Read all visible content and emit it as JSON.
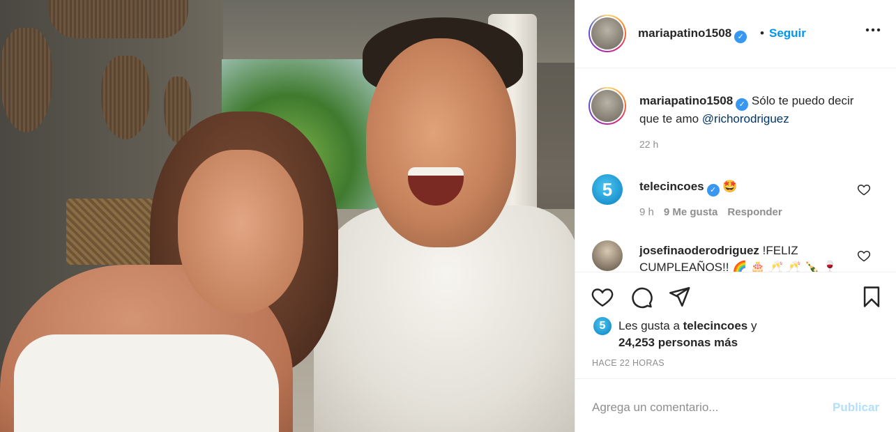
{
  "post": {
    "username": "mariapatino1508",
    "follow_label": "Seguir",
    "separator": "•",
    "more_icon": "more-horizontal-icon",
    "caption": {
      "username": "mariapatino1508",
      "text": "Sólo te puedo decir que te amo ",
      "mention": "@richorodriguez",
      "time": "22 h"
    },
    "comments": [
      {
        "username": "telecincoes",
        "avatar_text": "5",
        "text": "🤩",
        "time": "9 h",
        "likes": "9 Me gusta",
        "reply_label": "Responder"
      },
      {
        "username": "josefinaoderodriguez",
        "text": "!FELIZ CUMPLEAÑOS!! 🌈 🎂 🥂 🥂 🍾 🍷"
      }
    ],
    "likes": {
      "prefix": "Les gusta a ",
      "user": "telecincoes",
      "middle": " y",
      "count_text": "24,253 personas más",
      "avatar_text": "5"
    },
    "time_ago": "HACE 22 HORAS",
    "add_comment_placeholder": "Agrega un comentario...",
    "publish_label": "Publicar",
    "verified_mark": "✓"
  },
  "colors": {
    "accent": "#0095f6",
    "publish_disabled": "#b2dffc",
    "secondary_text": "#8e8e8e",
    "verified": "#3897f0"
  }
}
